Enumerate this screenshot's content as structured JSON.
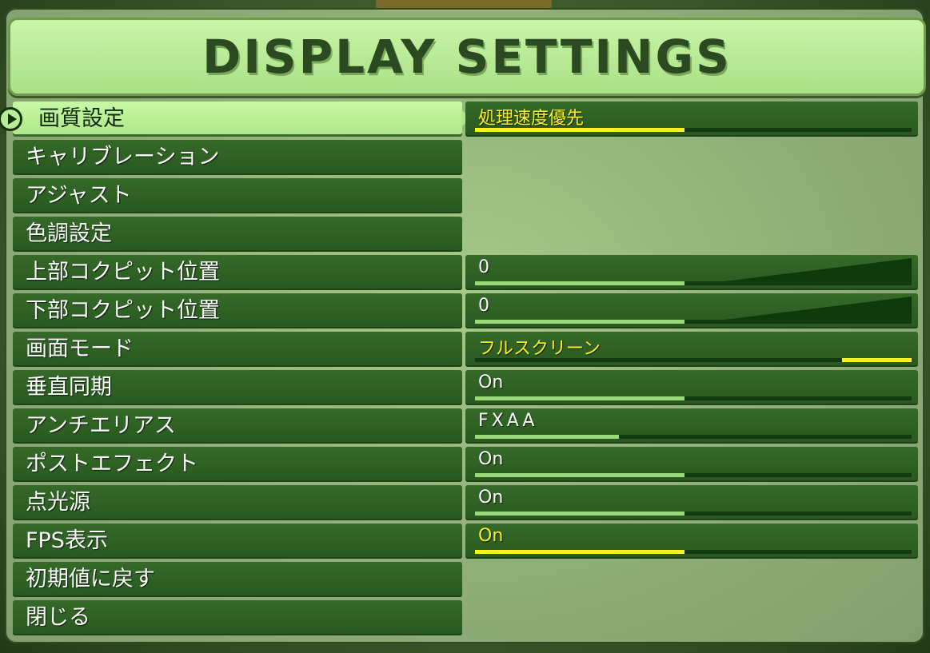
{
  "header": {
    "title": "DISPLAY SETTINGS"
  },
  "colors": {
    "accent_yellow": "#ffee22",
    "row_green": "#2e6224",
    "selected_green": "#b9ec96"
  },
  "selected_index": 0,
  "menu": [
    {
      "label": "画質設定",
      "value": "処理速度優先",
      "value_color": "yellow",
      "fill": 0.48,
      "fill_color": "yellow"
    },
    {
      "label": "キャリブレーション"
    },
    {
      "label": "アジャスト"
    },
    {
      "label": "色調設定"
    },
    {
      "label": "上部コクピット位置",
      "value": "0",
      "value_color": "white",
      "fill": 0.48,
      "fill_color": "green",
      "wedge": true
    },
    {
      "label": "下部コクピット位置",
      "value": "0",
      "value_color": "white",
      "fill": 0.48,
      "fill_color": "green",
      "wedge": true
    },
    {
      "label": "画面モード",
      "value": "フルスクリーン",
      "value_color": "yellow",
      "fill_start": 0.84,
      "fill": 0.16,
      "fill_color": "yellow"
    },
    {
      "label": "垂直同期",
      "value": "On",
      "value_color": "white",
      "fill": 0.48,
      "fill_color": "green"
    },
    {
      "label": "アンチエリアス",
      "value": "FXAA",
      "value_color": "white",
      "fill": 0.33,
      "fill_color": "green",
      "spaced": true
    },
    {
      "label": "ポストエフェクト",
      "value": "On",
      "value_color": "white",
      "fill": 0.48,
      "fill_color": "green"
    },
    {
      "label": "点光源",
      "value": "On",
      "value_color": "white",
      "fill": 0.48,
      "fill_color": "green"
    },
    {
      "label": "FPS表示",
      "value": "On",
      "value_color": "yellow",
      "fill": 0.48,
      "fill_color": "yellow"
    },
    {
      "label": "初期値に戻す"
    },
    {
      "label": "閉じる"
    }
  ]
}
